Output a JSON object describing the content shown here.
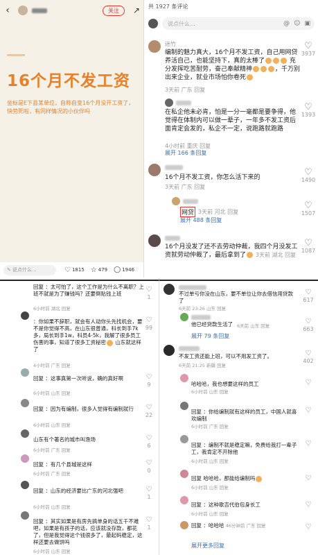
{
  "post": {
    "follow": "关注",
    "title": "16个月不发工资",
    "subtitle": "坐标是E下县某单位，自称自变16个月没开工资了，快劳死啦，有同样情况的小伙伴吗",
    "comment_placeholder": "说点什么…",
    "likes": "1815",
    "stars": "479",
    "comments": "1946"
  },
  "top_comments": {
    "header": "共 1927 条评论",
    "input_placeholder": "说点什么…",
    "c1": {
      "name": "迷竹",
      "text": "编制的魅力真大，16个月不发工资，自己用网贷养活自己，也能坚持下，真的太棒了",
      "text2": "充分发挥吃苦耐劳，奋己奉献精神",
      "text3": "，千万别出来企业，就业市场怕你卷死",
      "time": "3天前 广东 回复",
      "likes": "3937"
    },
    "c1r": {
      "text": "在私企他未必肯，怕是一分一毫都是要争得，他觉得在体制内可以做一辈子，一年多不发工资后面肯定会发的，私企不一定，说跑路就跑路",
      "time": "4小时前 重庆 回复",
      "likes": "1393",
      "expand": "展开 166 条回复"
    },
    "c2": {
      "text": "16个月不发工资，你怎么活下来的",
      "time": "3天前 广东 回复",
      "likes": "1490"
    },
    "c2r": {
      "text": "网贷",
      "time": "3天前 河北 回复",
      "likes": "1507",
      "expand": "展开 488 条回复"
    },
    "c3": {
      "text": "16个月没发了还不去劳动仲裁，我四个月没发工资就劳动仲裁了，最后拿到了",
      "time": "3天前 湖北 回复",
      "likes": "1087"
    }
  },
  "left_thread": {
    "r1": {
      "text": "回复 ：太可怕了，这个工作是为什么不离职？上班不就是为了赚钱吗？还要倒贴钱上班",
      "time": "6小时前 湖北 回复",
      "likes": "1"
    },
    "r2": {
      "text": "：你如果不辞职，就会有人动你头先找机会，要不是你觉得不高，在山东很普通，科长到手7k多，局长到手1w，科员4-5k，我解了很多员工伤害的事，知道了很多工资秘密",
      "text2": "山东就这样了",
      "time": "4小时前 广东 回复",
      "likes": "99"
    },
    "r3": {
      "text": "回复 ：这事真第一次听说，确的真好啊",
      "time": "6小时前 山东 回复",
      "likes": "9"
    },
    "r4": {
      "text": "回复 ：因为有编制，很多人觉得有编制就行",
      "time": "6小时前 山东 回复",
      "likes": "22"
    },
    "r5": {
      "text": "山东有个著名的城市叫渔场",
      "time": "6小时前 广东 回复",
      "likes": "6"
    },
    "r6": {
      "text": "回复 ：有几个县城是这样",
      "time": "6小时前 广东 回复",
      "likes": "0"
    },
    "r7": {
      "text": "回复 ：山东的经济要比广东的河北强吧",
      "time": "6小时前 山东 回复",
      "likes": "1"
    },
    "r8": {
      "text": "回复 ：其实如果是有房先搞单身的话五千不难吧，如果是有孩子的话，应该就没存款，都花了，但是我觉得这个钱很多了，最起码稳定，这样还要去做饼吗",
      "time": "6小时前 山东 回复",
      "likes": "1"
    }
  },
  "right_thread": {
    "r1": {
      "text": "不过单亏你没在山东，要不单位让你去借信用贷款了",
      "time": "6天前 23:26 山东 回复",
      "likes": "617"
    },
    "r1a": {
      "text": "他已经贷款生活了",
      "time": "6天前 山东 回复",
      "likes": "663"
    },
    "expand1": "展开 79 条回复",
    "r2": {
      "text": "不发工资还能上班，可以不用发工资了。",
      "time": "6天前 21:25 新疆 回复",
      "likes": "402"
    },
    "r3": {
      "text": "哈哈哈，我也想要这样的员工",
      "time": "6小时前 山东 回复",
      "likes": "0"
    },
    "r4": {
      "text": "回复 ：你给编制就有这样的员工，中国人就喜欢编制",
      "time": "6小时前 广东 回复",
      "likes": "0"
    },
    "r5": {
      "text": "回复 ：编制不就是稳定嘛，免费给我打一辈子工，我肯定不开除他",
      "time": "6小时前 山东 回复",
      "likes": "0"
    },
    "r6": {
      "text": "回复 哈哈哈，那能给编制吗",
      "time": "6小时前 山东 回复",
      "likes": "0"
    },
    "r7": {
      "text": "回复 ：这种歌吉代伯包身长工",
      "time": "6小时前 山东 回复",
      "likes": "0"
    },
    "r8": {
      "text": "回复 ：哈哈哈",
      "time": "46分钟前 广东 回复",
      "likes": "0"
    },
    "expand2": "展开更多回复"
  }
}
